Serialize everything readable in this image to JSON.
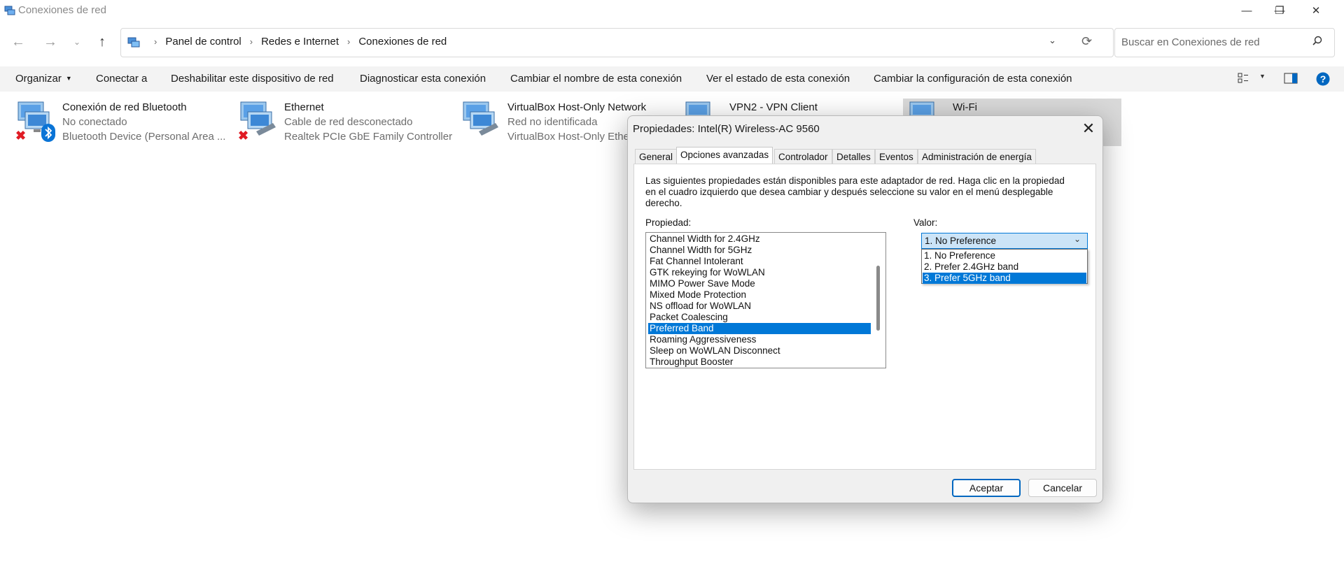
{
  "window": {
    "title": "Conexiones de red",
    "controls": {
      "minimize": "—",
      "restore": "❐",
      "close": "✕"
    }
  },
  "address": {
    "crumbs": [
      "Panel de control",
      "Redes e Internet",
      "Conexiones de red"
    ],
    "search_placeholder": "Buscar en Conexiones de red"
  },
  "toolbar": {
    "organize": "Organizar",
    "commands": [
      "Conectar a",
      "Deshabilitar este dispositivo de red",
      "Diagnosticar esta conexión",
      "Cambiar el nombre de esta conexión",
      "Ver el estado de esta conexión",
      "Cambiar la configuración de esta conexión"
    ]
  },
  "connections": [
    {
      "name": "Conexión de red Bluetooth",
      "status": "No conectado",
      "device": "Bluetooth Device (Personal Area ..."
    },
    {
      "name": "Ethernet",
      "status": "Cable de red desconectado",
      "device": "Realtek PCIe GbE Family Controller"
    },
    {
      "name": "VirtualBox Host-Only Network",
      "status": "Red no identificada",
      "device": "VirtualBox Host-Only Ethe"
    },
    {
      "name": "VPN2 - VPN Client"
    },
    {
      "name": "Wi-Fi"
    }
  ],
  "dialog": {
    "title": "Propiedades: Intel(R) Wireless-AC 9560",
    "close": "✕",
    "tabs": [
      "General",
      "Opciones avanzadas",
      "Controlador",
      "Detalles",
      "Eventos",
      "Administración de energía"
    ],
    "active_tab": "Opciones avanzadas",
    "description": [
      "Las siguientes propiedades están disponibles para este adaptador de red. Haga clic en la propiedad",
      "en el cuadro izquierdo que desea cambiar y después seleccione su valor en el menú desplegable",
      "derecho."
    ],
    "property_label": "Propiedad:",
    "value_label": "Valor:",
    "properties": [
      "Channel Width for 2.4GHz",
      "Channel Width for 5GHz",
      "Fat Channel Intolerant",
      "GTK rekeying for WoWLAN",
      "MIMO Power Save Mode",
      "Mixed Mode Protection",
      "NS offload for WoWLAN",
      "Packet Coalescing",
      "Preferred Band",
      "Roaming Aggressiveness",
      "Sleep on WoWLAN Disconnect",
      "Throughput Booster"
    ],
    "selected_property": "Preferred Band",
    "value_selected": "1. No Preference",
    "value_options": [
      "1. No Preference",
      "2. Prefer 2.4GHz band",
      "3. Prefer 5GHz band"
    ],
    "highlighted_option": "3. Prefer 5GHz band",
    "ok": "Aceptar",
    "cancel": "Cancelar"
  },
  "colors": {
    "accent": "#0078d7",
    "selection_bg": "#d9d9d9",
    "toolbar_bg": "#f3f3f3"
  }
}
